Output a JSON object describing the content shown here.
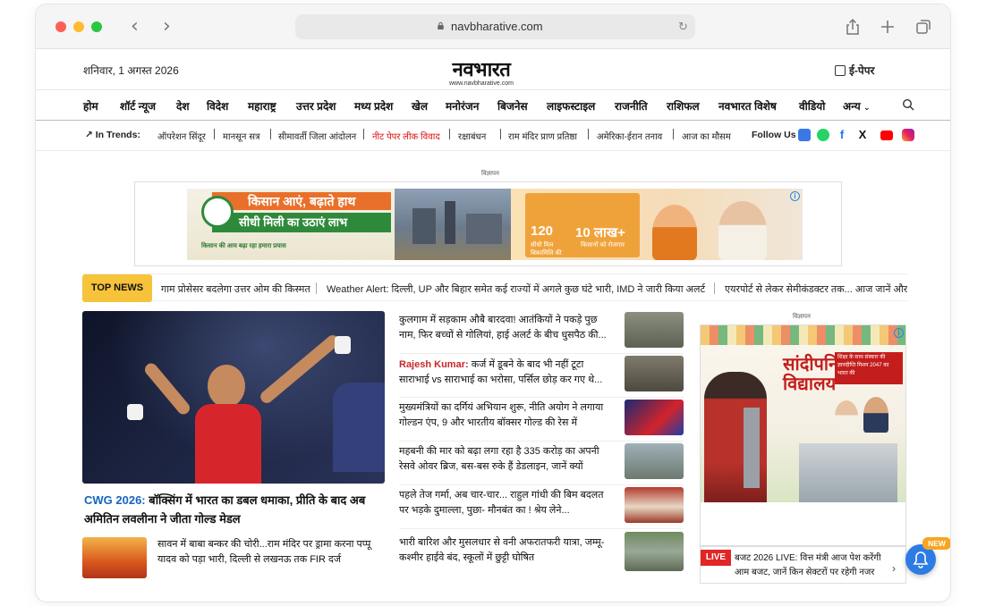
{
  "browser": {
    "url": "navbharative.com"
  },
  "site": {
    "date": "शनिवार, 1 अगस्त 2026",
    "logo_text": "नवभारत",
    "logo_sub": "www.navbharative.com",
    "epaper": "ई-पेपर"
  },
  "nav": {
    "items": [
      "होम",
      "शॉर्ट न्यूज",
      "देश",
      "विदेश",
      "महाराष्ट्र",
      "उत्तर प्रदेश",
      "मध्य प्रदेश",
      "खेल",
      "मनोरंजन",
      "बिजनेस",
      "लाइफस्टाइल",
      "राजनीति",
      "राशिफल",
      "नवभारत विशेष",
      "वीडियो",
      "अन्य"
    ]
  },
  "trends": {
    "label": "In Trends:",
    "items": [
      "ऑपरेशन सिंदूर",
      "मानसून सत्र",
      "सीमावर्ती जिला आंदोलन",
      "नीट पेपर लीक विवाद",
      "रक्षाबंधन",
      "राम मंदिर प्राण प्रतिष्ठा",
      "अमेरिका-ईरान तनाव",
      "आज का मौसम"
    ],
    "highlight_index": 3,
    "follow_label": "Follow Us"
  },
  "ad_top": {
    "label": "विज्ञापन",
    "headline1": "किसान आएं, बढ़ाते हाथ",
    "headline2": "सीधी मिली का उठाएं लाभ",
    "footer": "किसान की आय बढ़ा रहा हमारा प्रयास",
    "stat1_value": "120",
    "stat1_label": "सीधी मिल बिकामिलि की",
    "stat2_value": "10 लाख+",
    "stat2_label": "किसानों को रोजगार"
  },
  "ticker": {
    "badge": "TOP NEWS",
    "items": [
      "गाम प्रोसेसर बदलेगा उत्तर ओम की किस्मत",
      "Weather Alert: दिल्ली, UP और बिहार समेत कई राज्यों में अगले कुछ घंटे भारी, IMD ने जारी किया अलर्ट",
      "एयरपोर्ट से लेकर सेमीकंडक्टर तक... आज जानें और"
    ]
  },
  "lead": {
    "keyword": "CWG 2026:",
    "title": "बॉक्सिंग में भारत का डबल धमाका, प्रीति के बाद अब अमितिन लवलीना ने जीता गोल्ड मेडल"
  },
  "sub_story": {
    "title": "सावन में बाबा बन्कर की चोरी...राम मंदिर पर ड्रामा करना पप्पू यादव को पड़ा भारी, दिल्ली से लखनऊ तक FIR दर्ज"
  },
  "headlines": [
    {
      "keyword": "",
      "text": "कुलगाम में सड़काम औबै बारदवा! आतंकियों ने पकड़े पुछ नाम, फिर बच्चों से गोलियां, हाई अलर्ट के बीच धुसपैठ की..."
    },
    {
      "keyword": "Rajesh Kumar:",
      "text": "कर्ज में डूबने के बाद भी नहीं टूटा साराभाई vs साराभाई का भरोसा, पर्सिल छोड़ कर गए थे..."
    },
    {
      "keyword": "",
      "text": "मुख्यमंत्रियों का दर्गियं अभियान शुरू, नीति अयोग ने लगाया गोल्डन एंप, 9 और भारतीय बॉक्सर गोल्ड की रेस में"
    },
    {
      "keyword": "",
      "text": "महबनी की मार को बढ़ा लगा रहा है 335 करोड़ का अपनी रेसवे ओवर ब्रिज, बस-बस रुके हैं डेडलाइन, जानें क्यों"
    },
    {
      "keyword": "",
      "text": "पहले तेज गर्मा, अब चार-चार... राहुल गांधी की बिम बदलत पर भड़के दुमाल्ला, पुछा- मौनबंत का ! श्रेय लेने..."
    },
    {
      "keyword": "",
      "text": "भारी बारिश और मुसलधार से वनी अफरातफरी यात्रा, जम्मू-कश्मीर हाईवे बंद, स्कूलों में छुट्टी घोषित"
    }
  ],
  "ad_right": {
    "label": "विज्ञापन",
    "title_line1": "सांदीपनि",
    "title_line2": "विद्यालय",
    "sub": "शिक्षा के साथ संस्कार की ज्ञानदीप्ति मिशन 2047 का भारत की"
  },
  "live": {
    "badge": "LIVE",
    "text": "बजट 2026 LIVE: वित्त मंत्री आज पेश करेंगी आम बजट, जानें किन सेक्टरों पर रहेगी नजर"
  },
  "notify": {
    "new_tag": "NEW"
  },
  "colors": {
    "accent_red": "#e12626",
    "ticker_yellow": "#f6c33b",
    "link_blue": "#1565c0",
    "bell_blue": "#2d7be5"
  }
}
